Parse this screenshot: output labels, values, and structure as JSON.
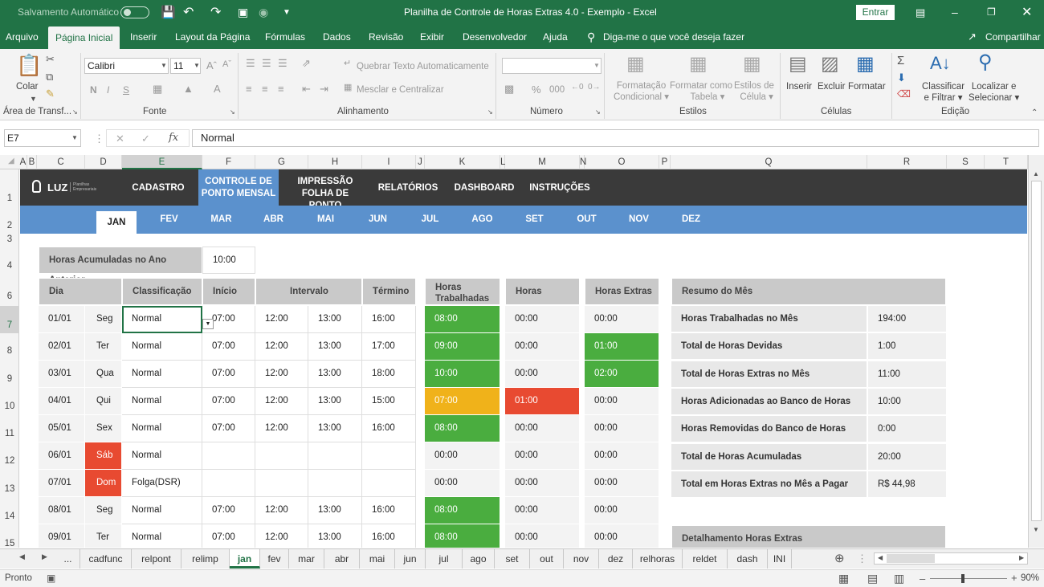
{
  "titlebar": {
    "autosave": "Salvamento Automático",
    "title": "Planilha de Controle de Horas Extras 4.0 - Exemplo  -  Excel",
    "signin": "Entrar"
  },
  "ribbon_tabs": [
    "Arquivo",
    "Página Inicial",
    "Inserir",
    "Layout da Página",
    "Fórmulas",
    "Dados",
    "Revisão",
    "Exibir",
    "Desenvolvedor",
    "Ajuda"
  ],
  "tellme": "Diga-me o que você deseja fazer",
  "share": "Compartilhar",
  "ribbon": {
    "paste": "Colar",
    "clipboard": "Área de Transf...",
    "font_group": "Fonte",
    "font_name": "Calibri",
    "font_size": "11",
    "bold": "N",
    "italic": "I",
    "underline": "S",
    "wrap": "Quebrar Texto Automaticamente",
    "merge": "Mesclar e Centralizar",
    "align_group": "Alinhamento",
    "number_group": "Número",
    "percent": "%",
    "thousands": "000",
    "cond_fmt_1": "Formatação",
    "cond_fmt_2": "Condicional",
    "fmt_table_1": "Formatar como",
    "fmt_table_2": "Tabela",
    "cell_styles_1": "Estilos de",
    "cell_styles_2": "Célula",
    "styles_group": "Estilos",
    "insert": "Inserir",
    "delete": "Excluir",
    "format": "Formatar",
    "cells_group": "Células",
    "sort_1": "Classificar",
    "sort_2": "e Filtrar",
    "find_1": "Localizar e",
    "find_2": "Selecionar",
    "editing_group": "Edição"
  },
  "formula_bar": {
    "namebox": "E7",
    "fx": "fx",
    "value": "Normal"
  },
  "columns": [
    "A",
    "B",
    "C",
    "D",
    "E",
    "F",
    "G",
    "H",
    "I",
    "J",
    "K",
    "L",
    "M",
    "N",
    "O",
    "P",
    "Q",
    "R",
    "S",
    "T"
  ],
  "rows": [
    "1",
    "2",
    "3",
    "4",
    "6",
    "7",
    "8",
    "9",
    "10",
    "11",
    "12",
    "13",
    "14",
    "15"
  ],
  "nav": {
    "logo": "LUZ",
    "logo_sub_1": "Planilhas",
    "logo_sub_2": "Empresariais",
    "items": [
      "CADASTRO",
      "CONTROLE DE",
      "PONTO MENSAL",
      "IMPRESSÃO",
      "FOLHA DE PONTO",
      "RELATÓRIOS",
      "DASHBOARD",
      "INSTRUÇÕES"
    ]
  },
  "months": [
    "JAN",
    "FEV",
    "MAR",
    "ABR",
    "MAI",
    "JUN",
    "JUL",
    "AGO",
    "SET",
    "OUT",
    "NOV",
    "DEZ"
  ],
  "prev_year": {
    "label": "Horas Acumuladas no Ano Anterior",
    "value": "10:00"
  },
  "table_headers": {
    "day": "Dia",
    "class": "Classificação",
    "start": "Início",
    "interval": "Intervalo",
    "end": "Término",
    "worked_1": "Horas",
    "worked_2": "Trabalhadas",
    "owed": "Horas Devidas",
    "extra": "Horas Extras"
  },
  "table_rows": [
    {
      "date": "01/01",
      "wd": "Seg",
      "cls": "Normal",
      "s": "07:00",
      "i1": "12:00",
      "i2": "13:00",
      "e": "16:00",
      "w": "08:00",
      "o": "00:00",
      "x": "00:00"
    },
    {
      "date": "02/01",
      "wd": "Ter",
      "cls": "Normal",
      "s": "07:00",
      "i1": "12:00",
      "i2": "13:00",
      "e": "17:00",
      "w": "09:00",
      "o": "00:00",
      "x": "01:00"
    },
    {
      "date": "03/01",
      "wd": "Qua",
      "cls": "Normal",
      "s": "07:00",
      "i1": "12:00",
      "i2": "13:00",
      "e": "18:00",
      "w": "10:00",
      "o": "00:00",
      "x": "02:00"
    },
    {
      "date": "04/01",
      "wd": "Qui",
      "cls": "Normal",
      "s": "07:00",
      "i1": "12:00",
      "i2": "13:00",
      "e": "15:00",
      "w": "07:00",
      "o": "01:00",
      "x": "00:00"
    },
    {
      "date": "05/01",
      "wd": "Sex",
      "cls": "Normal",
      "s": "07:00",
      "i1": "12:00",
      "i2": "13:00",
      "e": "16:00",
      "w": "08:00",
      "o": "00:00",
      "x": "00:00"
    },
    {
      "date": "06/01",
      "wd": "Sáb",
      "cls": "Normal",
      "s": "",
      "i1": "",
      "i2": "",
      "e": "",
      "w": "00:00",
      "o": "00:00",
      "x": "00:00"
    },
    {
      "date": "07/01",
      "wd": "Dom",
      "cls": "Folga(DSR)",
      "s": "",
      "i1": "",
      "i2": "",
      "e": "",
      "w": "00:00",
      "o": "00:00",
      "x": "00:00"
    },
    {
      "date": "08/01",
      "wd": "Seg",
      "cls": "Normal",
      "s": "07:00",
      "i1": "12:00",
      "i2": "13:00",
      "e": "16:00",
      "w": "08:00",
      "o": "00:00",
      "x": "00:00"
    },
    {
      "date": "09/01",
      "wd": "Ter",
      "cls": "Normal",
      "s": "07:00",
      "i1": "12:00",
      "i2": "13:00",
      "e": "16:00",
      "w": "08:00",
      "o": "00:00",
      "x": "00:00"
    }
  ],
  "summary": {
    "title": "Resumo do Mês",
    "items": [
      {
        "k": "Horas Trabalhadas no Mês",
        "v": "194:00"
      },
      {
        "k": "Total de Horas Devidas",
        "v": "1:00"
      },
      {
        "k": "Total de Horas Extras no Mês",
        "v": "11:00"
      },
      {
        "k": "Horas Adicionadas ao Banco de Horas",
        "v": "10:00"
      },
      {
        "k": "Horas Removidas do Banco de Horas",
        "v": "0:00"
      },
      {
        "k": "Total de Horas Acumuladas",
        "v": "20:00"
      },
      {
        "k": "Total em Horas Extras no Mês a Pagar",
        "v": "R$ 44,98"
      }
    ],
    "detail_title": "Detalhamento Horas Extras"
  },
  "sheet_tabs": [
    "...",
    "cadfunc",
    "relpont",
    "relimp",
    "jan",
    "fev",
    "mar",
    "abr",
    "mai",
    "jun",
    "jul",
    "ago",
    "set",
    "out",
    "nov",
    "dez",
    "relhoras",
    "reldet",
    "dash",
    "INI",
    "..."
  ],
  "status": {
    "ready": "Pronto",
    "zoom": "90%"
  }
}
